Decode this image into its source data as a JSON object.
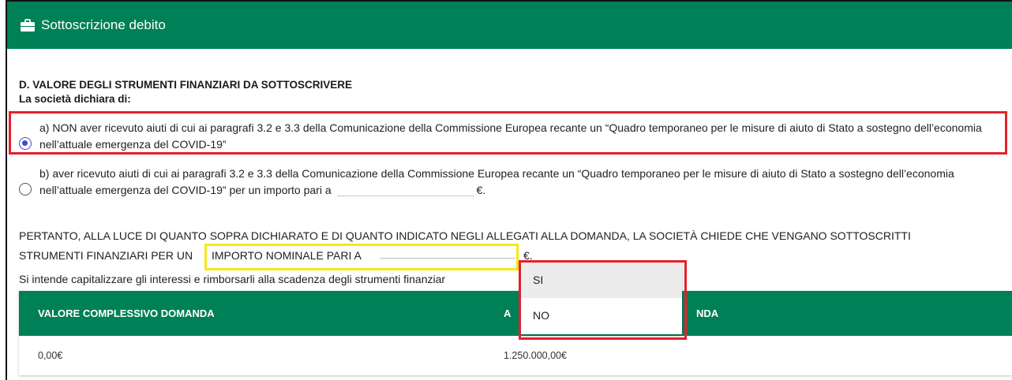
{
  "header": {
    "title": "Sottoscrizione debito",
    "icon": "briefcase-icon"
  },
  "form": {
    "section_title": "D. VALORE DEGLI STRUMENTI FINANZIARI DA SOTTOSCRIVERE",
    "declares": "La società dichiara di:",
    "option_a": {
      "selected": true,
      "text": "a) NON aver ricevuto aiuti di cui ai paragrafi 3.2 e 3.3 della Comunicazione della Commissione Europea recante un “Quadro temporaneo per le misure di aiuto di Stato a sostegno dell’economia nell’attuale emergenza del COVID-19”"
    },
    "option_b": {
      "selected": false,
      "text": "b) aver ricevuto aiuti di cui ai paragrafi 3.2 e 3.3 della Comunicazione della Commissione Europea recante un “Quadro temporaneo per le misure di aiuto di Stato a sostegno dell’economia nell’attuale emergenza del COVID-19” per un importo pari a",
      "amount_value": "",
      "currency": "€."
    },
    "pertanto_line1": "PERTANTO, ALLA LUCE DI QUANTO SOPRA DICHIARATO E DI QUANTO INDICATO NEGLI ALLEGATI ALLA DOMANDA, LA SOCIETÀ CHIEDE CHE VENGANO SOTTOSCRITTI",
    "pertanto_line2": "STRUMENTI FINANZIARI PER UN",
    "importo_label": "IMPORTO NOMINALE PARI A",
    "importo_value": "",
    "importo_currency": "€.",
    "capitalize_question": "Si intende capitalizzare gli interessi e rimborsarli alla scadenza degli strumenti finanziar"
  },
  "dropdown": {
    "options": [
      "SI",
      "NO"
    ],
    "highlighted": "SI"
  },
  "table": {
    "headers": [
      "VALORE COMPLESSIVO DOMANDA",
      "A",
      "NDA"
    ],
    "rows": [
      [
        "0,00€",
        "1.250.000,00€"
      ]
    ]
  },
  "colors": {
    "header_green": "#008057",
    "highlight_red": "#e4212b",
    "highlight_yellow": "#f5ea14",
    "radio_blue": "#3a4ec9"
  }
}
